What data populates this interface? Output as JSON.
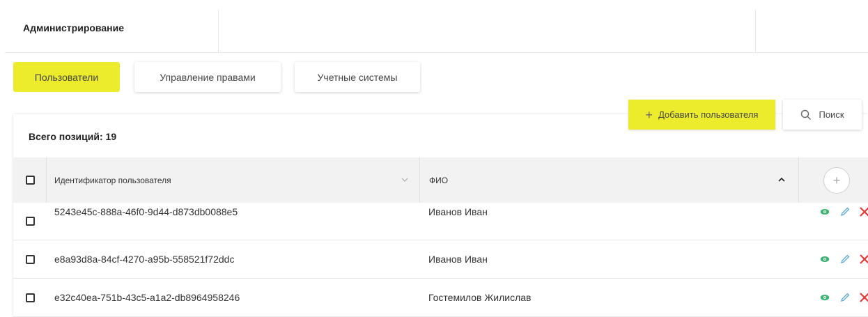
{
  "header": {
    "title": "Администрирование"
  },
  "tabs": [
    {
      "label": "Пользователи",
      "active": true
    },
    {
      "label": "Управление правами",
      "active": false
    },
    {
      "label": "Учетные системы",
      "active": false
    }
  ],
  "toolbar": {
    "add_label": "Добавить пользователя",
    "search_label": "Поиск"
  },
  "table": {
    "total_label": "Всего позиций: 19",
    "columns": [
      "Идентификатор пользователя",
      "ФИО"
    ],
    "rows": [
      {
        "id": "5243e45c-888a-46f0-9d44-d873db0088e5",
        "name": "Иванов Иван"
      },
      {
        "id": "e8a93d8a-84cf-4270-a95b-558521f72ddc",
        "name": "Иванов Иван"
      },
      {
        "id": "e32c40ea-751b-43c5-a1a2-db8964958246",
        "name": "Гостемилов Жилислав"
      }
    ]
  },
  "colors": {
    "accent": "#ecec2c",
    "view_icon": "#3cb371",
    "edit_icon": "#5aa9d6",
    "delete_icon": "#e53935"
  },
  "icons": [
    "plus-icon",
    "search-icon",
    "chevron-down-icon",
    "chevron-up-icon",
    "eye-icon",
    "pencil-icon",
    "close-icon"
  ]
}
